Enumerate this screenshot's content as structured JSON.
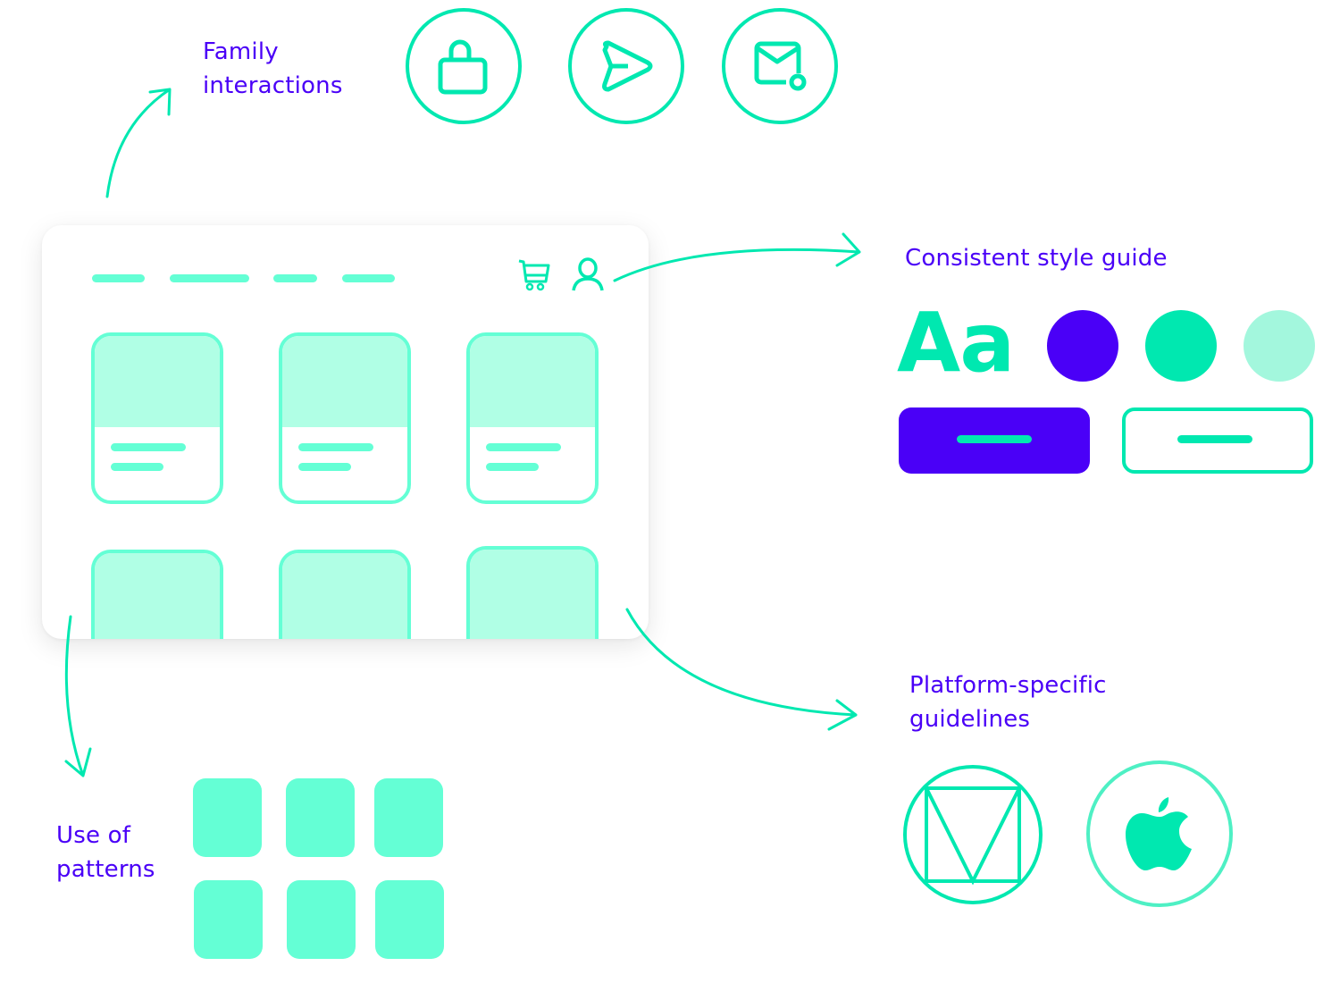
{
  "labels": {
    "family_interactions": [
      "Family",
      "interactions"
    ],
    "style_guide": "Consistent style guide",
    "platform_guidelines": [
      "Platform-specific",
      "guidelines"
    ],
    "patterns": [
      "Use of",
      "patterns"
    ]
  },
  "interaction_icons": [
    "lock-icon",
    "send-icon",
    "mail-settings-icon"
  ],
  "mockup": {
    "nav_items": 4,
    "header_icons": [
      "cart-icon",
      "user-icon"
    ],
    "product_cards": 6
  },
  "style_guide": {
    "typography_sample": "Aa",
    "palette": [
      "#4a00f7",
      "#00e8b0",
      "#a3f7dd"
    ],
    "buttons": [
      "primary-filled",
      "secondary-outline"
    ]
  },
  "platforms": [
    "material-design-icon",
    "apple-icon"
  ],
  "pattern_tiles": 6,
  "colors": {
    "primary": "#4a00f7",
    "accent": "#00e8b0",
    "accent_light": "#64ffd5",
    "accent_pale": "#b0ffe5"
  }
}
